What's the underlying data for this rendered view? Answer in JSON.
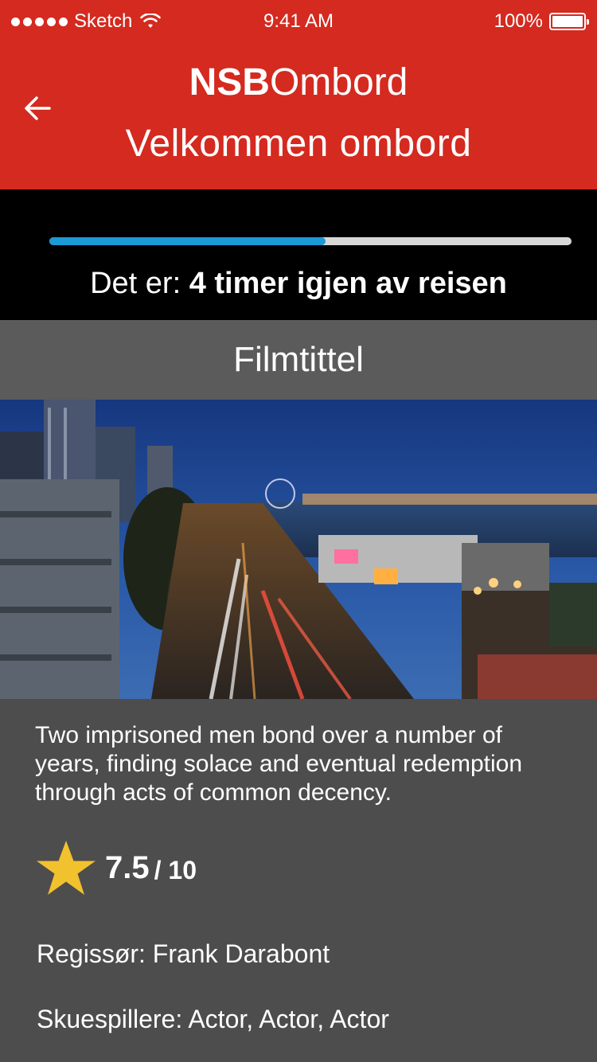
{
  "status_bar": {
    "carrier": "Sketch",
    "time": "9:41 AM",
    "battery": "100%"
  },
  "header": {
    "brand_bold": "NSB",
    "brand_regular": "Ombord",
    "subtitle": "Velkommen ombord",
    "color": "#d42a1f"
  },
  "journey": {
    "progress": 0.529,
    "remaining_prefix": "Det er: ",
    "remaining_text": "4 timer igjen av reisen",
    "progress_color": "#1a9ad6"
  },
  "film": {
    "title": "Filmtittel",
    "description": "Two imprisoned men bond over a number of years, finding solace and eventual redemption through acts of common decency.",
    "rating_value": "7.5",
    "rating_max": "/ 10",
    "director_label": "Regissør: ",
    "director": "Frank Darabont",
    "actors_label": "Skuespillere: ",
    "actors": "Actor, Actor, Actor"
  },
  "icons": {
    "back": "back-arrow-icon",
    "rating": "star-icon",
    "wifi": "wifi-icon",
    "battery": "battery-icon"
  }
}
